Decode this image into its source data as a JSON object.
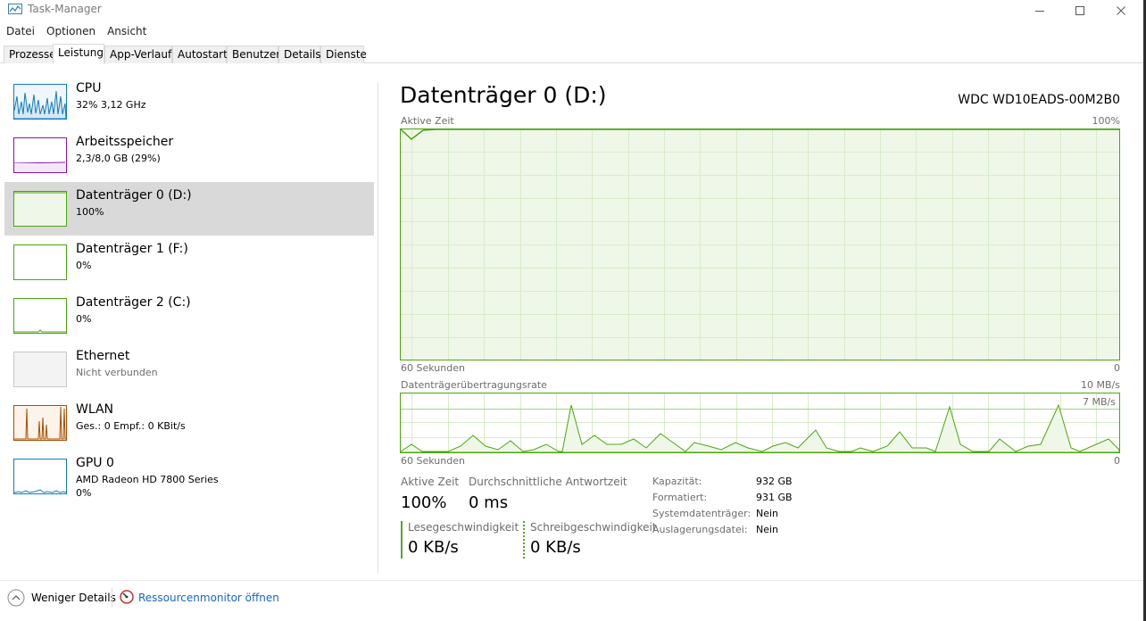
{
  "window": {
    "title": "Task-Manager"
  },
  "menu": [
    "Datei",
    "Optionen",
    "Ansicht"
  ],
  "tabs": [
    {
      "label": "Prozesse",
      "active": false
    },
    {
      "label": "Leistung",
      "active": true
    },
    {
      "label": "App-Verlauf",
      "active": false
    },
    {
      "label": "Autostart",
      "active": false
    },
    {
      "label": "Benutzer",
      "active": false
    },
    {
      "label": "Details",
      "active": false
    },
    {
      "label": "Dienste",
      "active": false
    }
  ],
  "resources": [
    {
      "title": "CPU",
      "sub": "32% 3,12 GHz",
      "color": "#117dbb"
    },
    {
      "title": "Arbeitsspeicher",
      "sub": "2,3/8,0 GB (29%)",
      "color": "#8b12ae"
    },
    {
      "title": "Datenträger 0 (D:)",
      "sub": "100%",
      "color": "#4da60c",
      "selected": true
    },
    {
      "title": "Datenträger 1 (F:)",
      "sub": "0%",
      "color": "#4da60c"
    },
    {
      "title": "Datenträger 2 (C:)",
      "sub": "0%",
      "color": "#4da60c"
    },
    {
      "title": "Ethernet",
      "sub": "Nicht verbunden",
      "color": "#a7a7a7"
    },
    {
      "title": "WLAN",
      "sub": "Ges.: 0 Empf.: 0 KBit/s",
      "color": "#a74f01"
    },
    {
      "title": "GPU 0",
      "sub": "AMD Radeon HD 7800 Series",
      "sub2": "0%",
      "color": "#117dbb"
    }
  ],
  "detail": {
    "title": "Datenträger 0 (D:)",
    "model": "WDC WD10EADS-00M2B0",
    "graph1": {
      "label": "Aktive Zeit",
      "max": "100%",
      "time": "60 Sekunden",
      "min": "0"
    },
    "graph2": {
      "label": "Datenträgerübertragungsrate",
      "max": "10 MB/s",
      "inner_max": "7 MB/s",
      "time": "60 Sekunden",
      "min": "0"
    },
    "stats": {
      "active_label": "Aktive Zeit",
      "active_value": "100%",
      "response_label": "Durchschnittliche Antwortzeit",
      "response_value": "0 ms",
      "read_label": "Lesegeschwindigkeit",
      "read_value": "0 KB/s",
      "write_label": "Schreibgeschwindigkeit",
      "write_value": "0 KB/s"
    },
    "properties": [
      {
        "key": "Kapazität:",
        "value": "932 GB"
      },
      {
        "key": "Formatiert:",
        "value": "931 GB"
      },
      {
        "key": "Systemdatenträger:",
        "value": "Nein"
      },
      {
        "key": "Auslagerungsdatei:",
        "value": "Nein"
      }
    ]
  },
  "footer": {
    "less_details": "Weniger Details",
    "resource_monitor": "Ressourcenmonitor öffnen"
  },
  "colors": {
    "disk_green": "#4da60c",
    "disk_fill": "#eff7e9",
    "grid": "#d8ecc8",
    "selected_bg": "#d9d9d9",
    "link": "#1a66c2"
  }
}
